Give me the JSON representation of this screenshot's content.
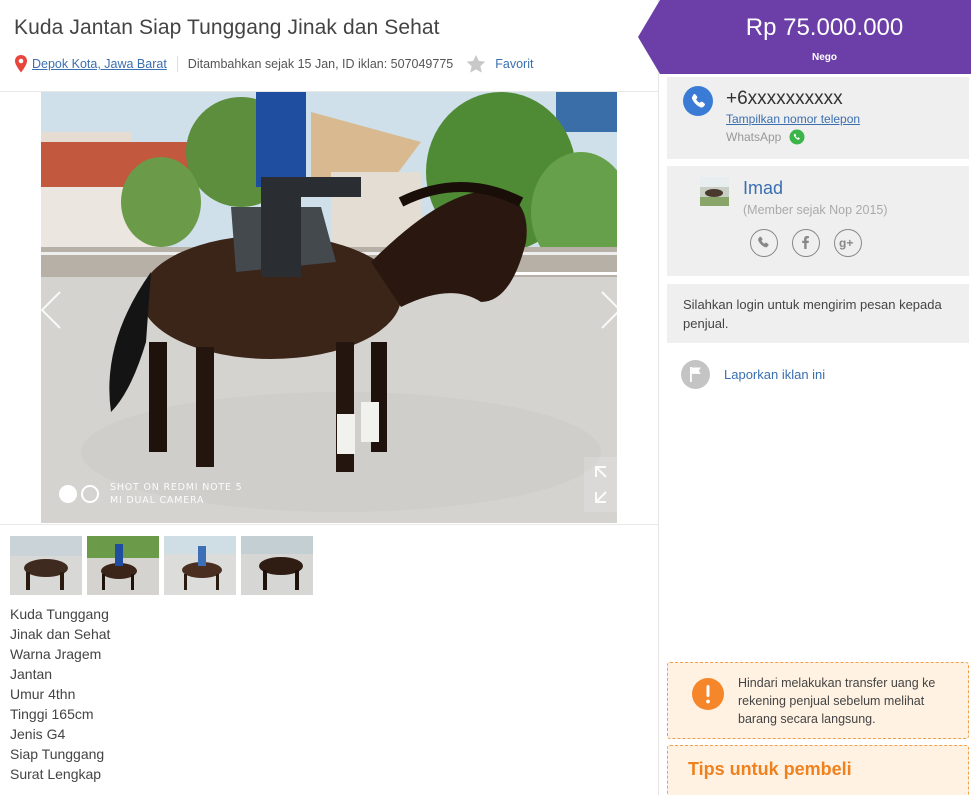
{
  "listing": {
    "title": "Kuda Jantan Siap Tunggang Jinak dan Sehat",
    "location": "Depok Kota, Jawa Barat",
    "added_meta": "Ditambahkan sejak 15 Jan, ID iklan: 507049775",
    "favorite_label": "Favorit",
    "price": "Rp 75.000.000",
    "price_note": "Nego"
  },
  "gallery": {
    "watermark_line1": "SHOT ON REDMI NOTE 5",
    "watermark_line2": "MI DUAL CAMERA",
    "thumbnail_count": 4,
    "active_thumbnail": 2
  },
  "description": [
    "Kuda Tunggang",
    "Jinak dan Sehat",
    "Warna Jragem",
    "Jantan",
    "Umur 4thn",
    "Tinggi 165cm",
    "Jenis G4",
    "Siap Tunggang",
    "Surat Lengkap"
  ],
  "contact": {
    "phone_masked": "+6xxxxxxxxxx",
    "show_phone_label": "Tampilkan nomor telepon",
    "whatsapp_label": "WhatsApp"
  },
  "seller": {
    "name": "Imad",
    "member_since": "(Member sejak Nop 2015)"
  },
  "login_message": "Silahkan login untuk mengirim pesan kepada penjual.",
  "report_label": "Laporkan iklan ini",
  "warning": "Hindari melakukan transfer uang ke rekening penjual sebelum melihat barang secara langsung.",
  "tips_title": "Tips untuk pembeli",
  "colors": {
    "brand_purple": "#6c3fa8",
    "link_blue": "#3a6fb0",
    "warning_orange": "#f5862a"
  },
  "icons": [
    "location-pin-icon",
    "star-icon",
    "chevron-left-icon",
    "chevron-right-icon",
    "fullscreen-icon",
    "phone-icon",
    "whatsapp-icon",
    "avatar",
    "phone-circle-icon",
    "facebook-icon",
    "google-plus-icon",
    "flag-icon",
    "exclamation-icon"
  ]
}
